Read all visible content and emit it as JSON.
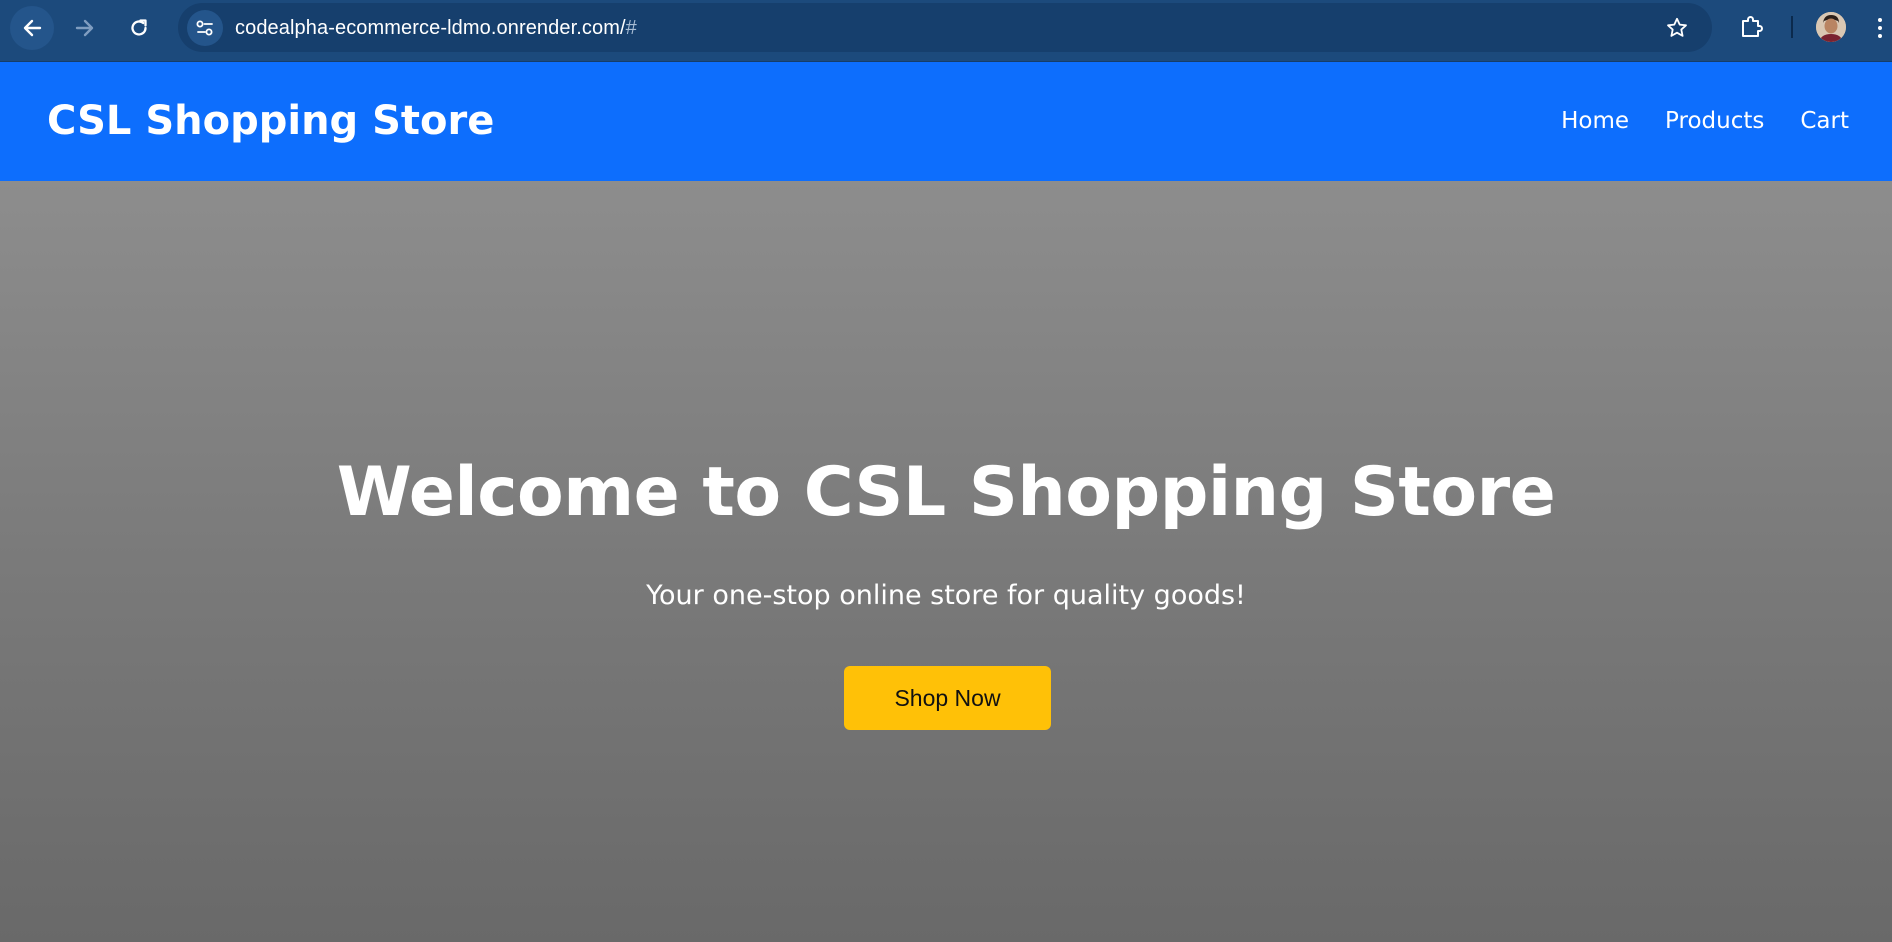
{
  "browser": {
    "url_main": "codealpha-ecommerce-ldmo.onrender.com/",
    "url_hash": "#",
    "icons": {
      "back": "arrow-left-icon",
      "forward": "arrow-right-icon",
      "reload": "reload-icon",
      "site_info": "tune-icon",
      "bookmark": "star-icon",
      "extensions": "puzzle-icon",
      "menu": "kebab-menu-icon"
    }
  },
  "header": {
    "brand": "CSL Shopping Store",
    "nav": {
      "home": "Home",
      "products": "Products",
      "cart": "Cart"
    }
  },
  "hero": {
    "title": "Welcome to CSL Shopping Store",
    "subtitle": "Your one-stop online store for quality goods!",
    "cta_label": "Shop Now"
  },
  "colors": {
    "browser_bar": "#1c4a7c",
    "header": "#0d6efd",
    "cta": "#ffc107",
    "hero_top": "#8d8d8d",
    "hero_bottom": "#696969"
  }
}
